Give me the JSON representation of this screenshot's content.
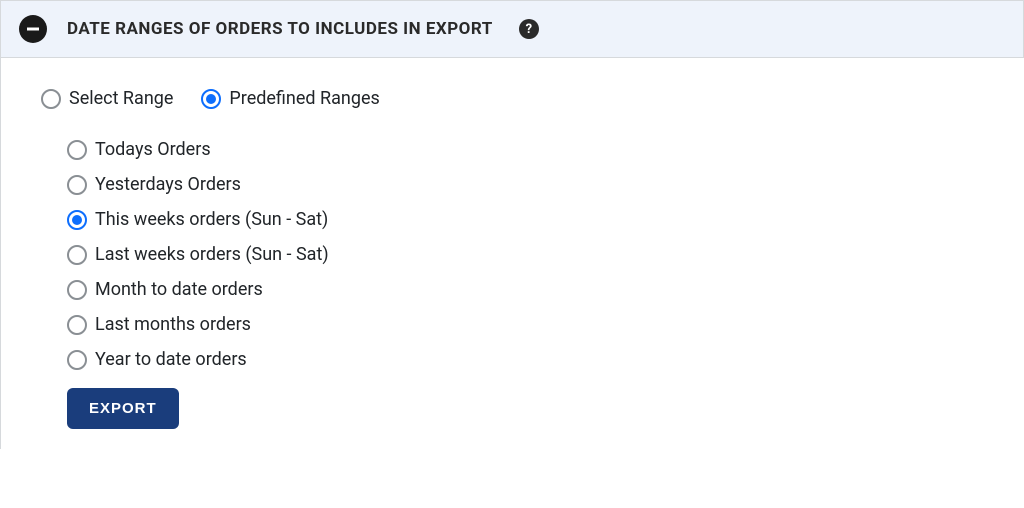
{
  "panel": {
    "title": "DATE RANGES OF ORDERS TO INCLUDES IN EXPORT"
  },
  "rangeMode": {
    "options": [
      {
        "label": "Select Range",
        "selected": false
      },
      {
        "label": "Predefined Ranges",
        "selected": true
      }
    ]
  },
  "predefined": {
    "options": [
      {
        "label": "Todays Orders",
        "selected": false
      },
      {
        "label": "Yesterdays Orders",
        "selected": false
      },
      {
        "label": "This weeks orders (Sun - Sat)",
        "selected": true
      },
      {
        "label": "Last weeks orders (Sun - Sat)",
        "selected": false
      },
      {
        "label": "Month to date orders",
        "selected": false
      },
      {
        "label": "Last months orders",
        "selected": false
      },
      {
        "label": "Year to date orders",
        "selected": false
      }
    ]
  },
  "buttons": {
    "export": "EXPORT"
  },
  "help": {
    "glyph": "?"
  }
}
